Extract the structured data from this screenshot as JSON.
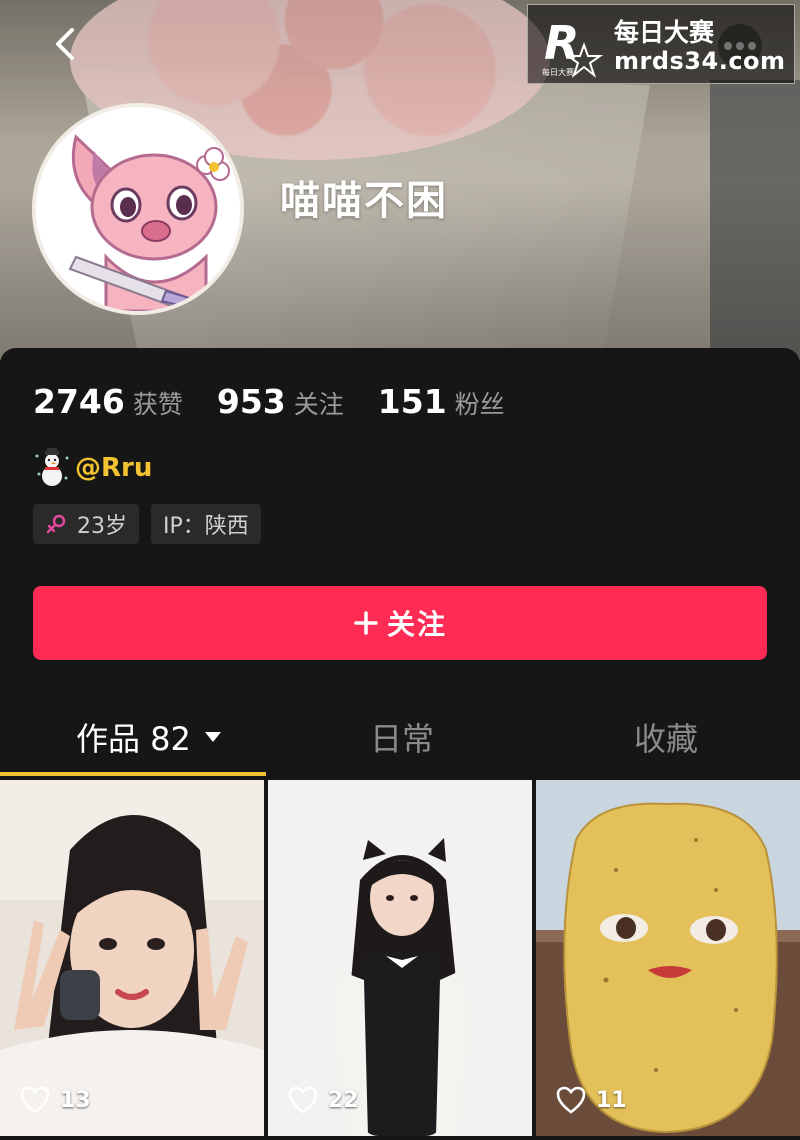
{
  "header": {
    "back_icon": "chevron-left-icon",
    "more_icon": "more-dots-icon",
    "watermark": {
      "logo_letter": "R",
      "logo_caption": "每日大赛",
      "line1": "每日大赛",
      "line2": "mrds34.com"
    }
  },
  "profile": {
    "display_name": "喵喵不困",
    "stats": [
      {
        "value": "2746",
        "label": "获赞"
      },
      {
        "value": "953",
        "label": "关注"
      },
      {
        "value": "151",
        "label": "粉丝"
      }
    ],
    "handle": "@Rru",
    "tags": {
      "age": "23岁",
      "ip": "IP：陕西"
    },
    "follow_label": "关注"
  },
  "tabs": [
    {
      "label": "作品 82",
      "active": true
    },
    {
      "label": "日常",
      "active": false
    },
    {
      "label": "收藏",
      "active": false
    }
  ],
  "posts": [
    {
      "likes": "13",
      "subject": "girl-peace-sign"
    },
    {
      "likes": "22",
      "subject": "girl-cat-ears"
    },
    {
      "likes": "11",
      "subject": "potato-face"
    }
  ],
  "colors": {
    "accent_red": "#fe2c55",
    "handle_yellow": "#f2c230",
    "background": "#161616"
  }
}
